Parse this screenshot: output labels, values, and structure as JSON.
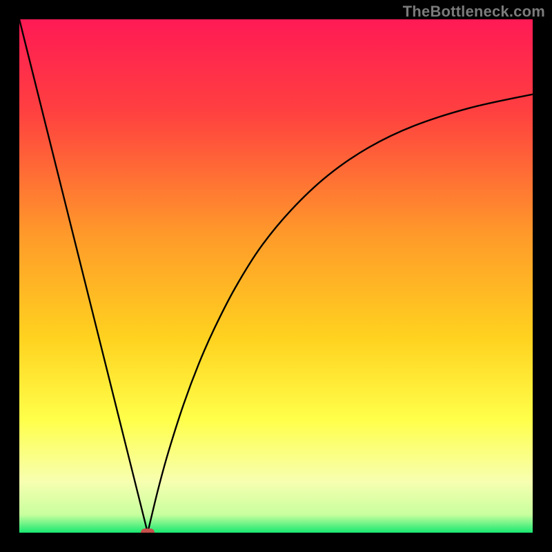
{
  "watermark": "TheBottleneck.com",
  "chart_data": {
    "type": "line",
    "title": "",
    "xlabel": "",
    "ylabel": "",
    "xlim": [
      0,
      100
    ],
    "ylim": [
      0,
      100
    ],
    "grid": false,
    "legend": false,
    "background_gradient_stops": [
      {
        "offset": 0.0,
        "color": "#ff1a55"
      },
      {
        "offset": 0.18,
        "color": "#ff4040"
      },
      {
        "offset": 0.42,
        "color": "#ff9a2a"
      },
      {
        "offset": 0.62,
        "color": "#ffd21f"
      },
      {
        "offset": 0.78,
        "color": "#ffff4a"
      },
      {
        "offset": 0.9,
        "color": "#f7ffb0"
      },
      {
        "offset": 0.965,
        "color": "#c8ff9e"
      },
      {
        "offset": 1.0,
        "color": "#18e870"
      }
    ],
    "series": [
      {
        "name": "left-branch",
        "x": [
          0,
          2.8,
          5.6,
          8.4,
          11.2,
          14.0,
          16.8,
          19.6,
          22.4,
          25.0
        ],
        "y": [
          100,
          88.8,
          77.6,
          66.4,
          55.2,
          44.0,
          32.8,
          21.6,
          10.4,
          0.0
        ]
      },
      {
        "name": "right-branch",
        "x": [
          25.0,
          27,
          29,
          32,
          35,
          38,
          42,
          47,
          53,
          60,
          68,
          77,
          88,
          100
        ],
        "y": [
          0.0,
          8.3,
          15.6,
          25.0,
          33.0,
          39.8,
          47.6,
          55.6,
          62.9,
          69.5,
          75.0,
          79.3,
          82.8,
          85.4
        ]
      }
    ],
    "marker": {
      "x": 25.0,
      "y": 0.0,
      "color": "#c64f4b"
    }
  }
}
